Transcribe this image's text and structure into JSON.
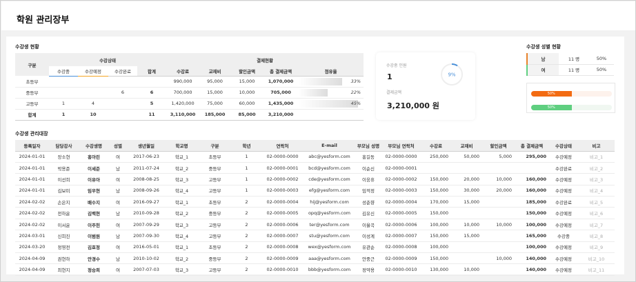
{
  "app_title": "학원 관리장부",
  "status_section": {
    "title": "수강생 현황",
    "col_division": "구분",
    "group_status": "수강상태",
    "group_payment": "결제현황",
    "sub_headers": {
      "enrolled": "수강중",
      "reserved": "수강예정",
      "completed": "수강완료",
      "sum": "합계",
      "fee": "수강료",
      "book": "교재비",
      "discount": "할인금액",
      "total": "총 결제금액",
      "share": "점유율"
    },
    "rows": [
      {
        "division": "초등부",
        "enrolled": "",
        "reserved": "",
        "completed": "",
        "sum": "",
        "fee": "990,000",
        "book": "95,000",
        "discount": "15,000",
        "total": "1,070,000",
        "share": "33%",
        "share_value": 33
      },
      {
        "division": "중등부",
        "enrolled": "",
        "reserved": "",
        "completed": "6",
        "sum": "6",
        "fee": "700,000",
        "book": "15,000",
        "discount": "10,000",
        "total": "705,000",
        "share": "22%",
        "share_value": 22
      },
      {
        "division": "고등부",
        "enrolled": "1",
        "reserved": "4",
        "completed": "",
        "sum": "5",
        "fee": "1,420,000",
        "book": "75,000",
        "discount": "60,000",
        "total": "1,435,000",
        "share": "45%",
        "share_value": 45
      }
    ],
    "total_row": {
      "division": "합계",
      "enrolled": "1",
      "reserved": "10",
      "completed": "",
      "sum": "11",
      "fee": "3,110,000",
      "book": "185,000",
      "discount": "85,000",
      "total": "3,210,000",
      "share": ""
    }
  },
  "stat_card": {
    "count_label": "수강중 인원",
    "count_value": "1",
    "ring_label": "9%",
    "ring_value": 9,
    "amount_label": "결제금액",
    "amount_value": "3,210,000 원"
  },
  "gender_section": {
    "title": "수강생 성별 현황",
    "rows": [
      {
        "gender": "남",
        "count": "11 명",
        "percent": "50%"
      },
      {
        "gender": "여",
        "count": "11 명",
        "percent": "50%"
      }
    ],
    "bars": [
      {
        "label": "50%",
        "value": 50,
        "color": "#f36b12"
      },
      {
        "label": "50%",
        "value": 50,
        "color": "#5fcf80"
      }
    ]
  },
  "ledger": {
    "title": "수강생 관리대장",
    "headers": [
      "등록일자",
      "담당강사",
      "수강생명",
      "성별",
      "생년월일",
      "학교명",
      "구분",
      "학년",
      "연락처",
      "E-mail",
      "부모님 성명",
      "부모님 연락처",
      "수강료",
      "교재비",
      "할인금액",
      "총 결제금액",
      "수강상태",
      "비고"
    ],
    "rows": [
      {
        "date": "2024-01-01",
        "teacher": "장소현",
        "student": "홍아린",
        "gender": "여",
        "birth": "2017-06-23",
        "school": "학교_1",
        "division": "초등부",
        "grade": "1",
        "phone": "02-0000-0000",
        "email": "abc@yesform.com",
        "parent": "홍길동",
        "parent_phone": "02-0000-0000",
        "fee": "250,000",
        "book": "50,000",
        "discount": "5,000",
        "total": "295,000",
        "status": "수강예정",
        "note": "비고_1"
      },
      {
        "date": "2024-01-01",
        "teacher": "박용준",
        "student": "이세준",
        "gender": "남",
        "birth": "2011-07-24",
        "school": "학교_2",
        "division": "중등부",
        "grade": "1",
        "phone": "02-0000-0001",
        "email": "bcd@yesform.com",
        "parent": "이순신",
        "parent_phone": "02-0000-0001",
        "fee": "",
        "book": "",
        "discount": "",
        "total": "",
        "status": "수강완료",
        "note": "비고_2"
      },
      {
        "date": "2024-01-01",
        "teacher": "이선희",
        "student": "이유아",
        "gender": "여",
        "birth": "2008-08-25",
        "school": "학교_3",
        "division": "고등부",
        "grade": "1",
        "phone": "02-0000-0002",
        "email": "cde@yesform.com",
        "parent": "이웅휴",
        "parent_phone": "02-0000-0002",
        "fee": "150,000",
        "book": "20,000",
        "discount": "10,000",
        "total": "160,000",
        "status": "수강예정",
        "note": "비고_3"
      },
      {
        "date": "2024-01-01",
        "teacher": "김보미",
        "student": "임우현",
        "gender": "남",
        "birth": "2008-09-26",
        "school": "학교_4",
        "division": "고등부",
        "grade": "1",
        "phone": "02-0000-0003",
        "email": "efg@yesform.com",
        "parent": "임적정",
        "parent_phone": "02-0000-0003",
        "fee": "150,000",
        "book": "30,000",
        "discount": "20,000",
        "total": "160,000",
        "status": "수강예정",
        "note": "비고_4"
      },
      {
        "date": "2024-02-02",
        "teacher": "손은지",
        "student": "배수지",
        "gender": "여",
        "birth": "2016-09-27",
        "school": "학교_1",
        "division": "초등부",
        "grade": "2",
        "phone": "02-0000-0004",
        "email": "hij@yesform.com",
        "parent": "성춘향",
        "parent_phone": "02-0000-0004",
        "fee": "170,000",
        "book": "15,000",
        "discount": "",
        "total": "185,000",
        "status": "수강완료",
        "note": "비고_5"
      },
      {
        "date": "2024-02-02",
        "teacher": "전하윤",
        "student": "김백현",
        "gender": "남",
        "birth": "2010-09-28",
        "school": "학교_2",
        "division": "중등부",
        "grade": "2",
        "phone": "02-0000-0005",
        "email": "opq@yesform.com",
        "parent": "김유신",
        "parent_phone": "02-0000-0005",
        "fee": "150,000",
        "book": "",
        "discount": "",
        "total": "150,000",
        "status": "수강예정",
        "note": "비고_6"
      },
      {
        "date": "2024-02-02",
        "teacher": "이서윤",
        "student": "이주헌",
        "gender": "여",
        "birth": "2007-09-29",
        "school": "학교_3",
        "division": "고등부",
        "grade": "2",
        "phone": "02-0000-0006",
        "email": "ter@yesform.com",
        "parent": "이율곡",
        "parent_phone": "02-0000-0006",
        "fee": "100,000",
        "book": "10,000",
        "discount": "10,000",
        "total": "100,000",
        "status": "수강예정",
        "note": "비고_7"
      },
      {
        "date": "2024-03-01",
        "teacher": "신희진",
        "student": "이범원",
        "gender": "남",
        "birth": "2007-09-30",
        "school": "학교_4",
        "division": "고등부",
        "grade": "2",
        "phone": "02-0000-0007",
        "email": "stu@yesform.com",
        "parent": "이성계",
        "parent_phone": "02-0000-0007",
        "fee": "150,000",
        "book": "15,000",
        "discount": "",
        "total": "165,000",
        "status": "수강중",
        "note": "비고_8"
      },
      {
        "date": "2024-03-20",
        "teacher": "정영전",
        "student": "김효정",
        "gender": "여",
        "birth": "2016-05-01",
        "school": "학교_1",
        "division": "초등부",
        "grade": "2",
        "phone": "02-0000-0008",
        "email": "wex@yesform.com",
        "parent": "유관순",
        "parent_phone": "02-0000-0008",
        "fee": "100,000",
        "book": "",
        "discount": "",
        "total": "100,000",
        "status": "수강예정",
        "note": "비고_9"
      },
      {
        "date": "2024-04-09",
        "teacher": "권현하",
        "student": "안경수",
        "gender": "남",
        "birth": "2010-10-02",
        "school": "학교_2",
        "division": "중등부",
        "grade": "2",
        "phone": "02-0000-0009",
        "email": "aaa@yesform.com",
        "parent": "안중근",
        "parent_phone": "02-0000-0009",
        "fee": "150,000",
        "book": "",
        "discount": "10,000",
        "total": "140,000",
        "status": "수강예정",
        "note": "비고_10"
      },
      {
        "date": "2024-04-09",
        "teacher": "최현지",
        "student": "정승희",
        "gender": "여",
        "birth": "2007-07-03",
        "school": "학교_3",
        "division": "고등부",
        "grade": "2",
        "phone": "02-0000-0010",
        "email": "bbb@yesform.com",
        "parent": "정약용",
        "parent_phone": "02-0000-0010",
        "fee": "130,000",
        "book": "10,000",
        "discount": "",
        "total": "140,000",
        "status": "수강예정",
        "note": "비고_11"
      }
    ]
  },
  "colors": {
    "enrolled": "#4a90d9",
    "reserved": "#f5a623",
    "completed": "#999999",
    "male": "#5cb85c",
    "female": "#e66d6d"
  }
}
